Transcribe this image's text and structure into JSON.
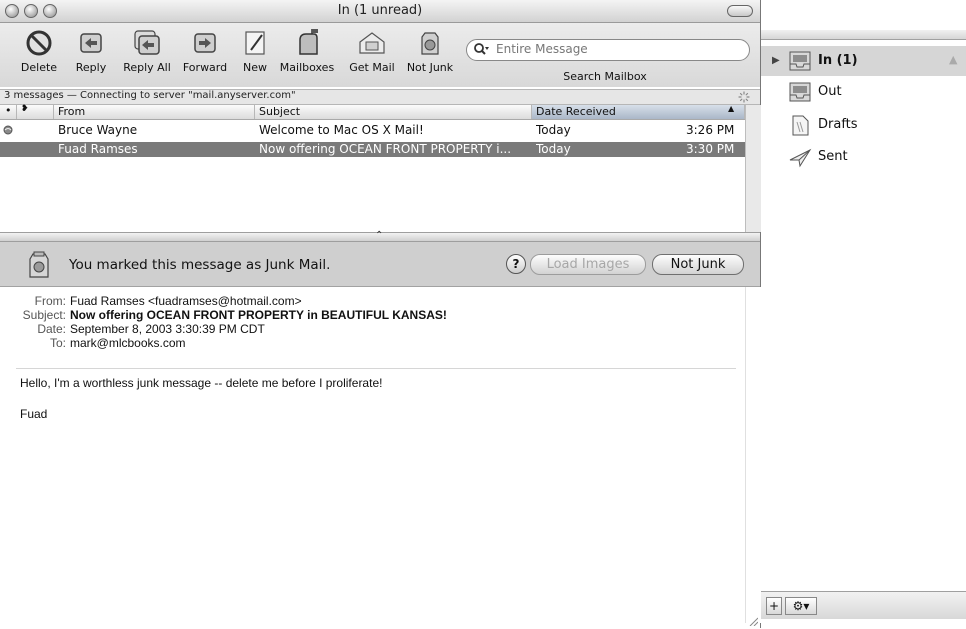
{
  "window": {
    "title": "In (1 unread)"
  },
  "toolbar": {
    "delete": "Delete",
    "reply": "Reply",
    "reply_all": "Reply All",
    "forward": "Forward",
    "new": "New",
    "mailboxes": "Mailboxes",
    "get_mail": "Get Mail",
    "not_junk": "Not Junk"
  },
  "search": {
    "placeholder": "Entire Message",
    "label": "Search Mailbox"
  },
  "status": {
    "text": "3 messages — Connecting to server \"mail.anyserver.com\""
  },
  "list": {
    "columns": {
      "from": "From",
      "subject": "Subject",
      "date_received": "Date Received"
    },
    "rows": [
      {
        "from": "Bruce Wayne",
        "subject": "Welcome to Mac OS X Mail!",
        "date": "Today",
        "time": "3:26 PM",
        "unread": true
      },
      {
        "from": "Fuad Ramses",
        "subject": "Now offering OCEAN FRONT PROPERTY i...",
        "date": "Today",
        "time": "3:30 PM",
        "selected": true
      }
    ]
  },
  "junk_banner": {
    "text": "You marked this message as Junk Mail.",
    "help": "?",
    "load_images": "Load Images",
    "not_junk": "Not Junk"
  },
  "message": {
    "labels": {
      "from": "From:",
      "subject": "Subject:",
      "date": "Date:",
      "to": "To:"
    },
    "from": "Fuad Ramses <fuadramses@hotmail.com>",
    "subject": "Now offering OCEAN FRONT PROPERTY in BEAUTIFUL KANSAS!",
    "date": "September 8, 2003 3:30:39 PM CDT",
    "to": "mark@mlcbooks.com",
    "body": [
      "Hello, I'm a worthless junk message -- delete me before I proliferate!",
      "Fuad"
    ]
  },
  "mailboxes": [
    {
      "label": "In (1)",
      "icon": "inbox-tray-icon"
    },
    {
      "label": "Out",
      "icon": "outbox-tray-icon"
    },
    {
      "label": "Drafts",
      "icon": "drafts-page-icon"
    },
    {
      "label": "Sent",
      "icon": "paper-plane-icon"
    }
  ],
  "drawer_buttons": {
    "add": "+",
    "action": "⚙▾"
  }
}
